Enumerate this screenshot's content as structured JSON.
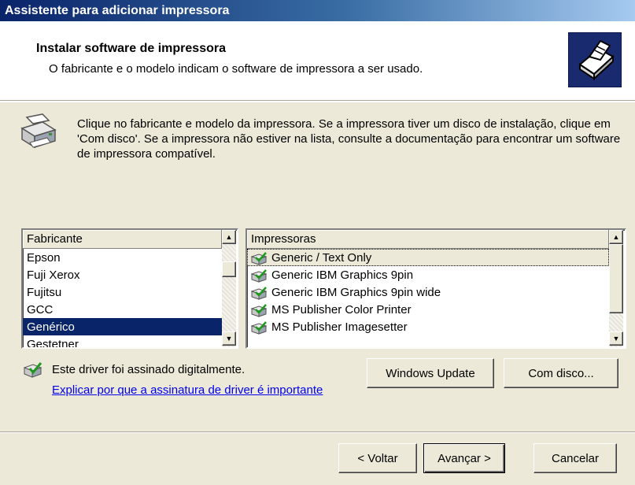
{
  "window": {
    "title": "Assistente para adicionar impressora"
  },
  "header": {
    "title": "Instalar software de impressora",
    "subtitle": "O fabricante e o modelo indicam o software de impressora a ser usado.",
    "icon": "printer-wizard-icon"
  },
  "info": {
    "icon": "printer-icon",
    "text": "Clique no fabricante e modelo da impressora. Se a impressora tiver um disco de instalação, clique em 'Com disco'. Se a impressora não estiver na lista, consulte a documentação para encontrar um software de impressora compatível."
  },
  "manufacturers": {
    "header": "Fabricante",
    "items": [
      "Epson",
      "Fuji Xerox",
      "Fujitsu",
      "GCC",
      "Genérico",
      "Gestetner"
    ],
    "selected": "Genérico"
  },
  "printers": {
    "header": "Impressoras",
    "items": [
      "Generic / Text Only",
      "Generic IBM Graphics 9pin",
      "Generic IBM Graphics 9pin wide",
      "MS Publisher Color Printer",
      "MS Publisher Imagesetter"
    ],
    "selected": "Generic / Text Only",
    "item_icon": "signed-printer-icon"
  },
  "driver": {
    "signed_text": "Este driver foi assinado digitalmente.",
    "link": "Explicar por que a assinatura de driver é importante",
    "icon": "signed-driver-icon"
  },
  "buttons": {
    "windows_update": "Windows Update",
    "have_disk": "Com disco...",
    "back": "< Voltar",
    "next": "Avançar >",
    "cancel": "Cancelar"
  },
  "colors": {
    "title_start": "#0a246a",
    "title_end": "#a6caf0",
    "dialog_bg": "#ece9d8",
    "selection": "#0a246a",
    "link": "#0000ee"
  }
}
